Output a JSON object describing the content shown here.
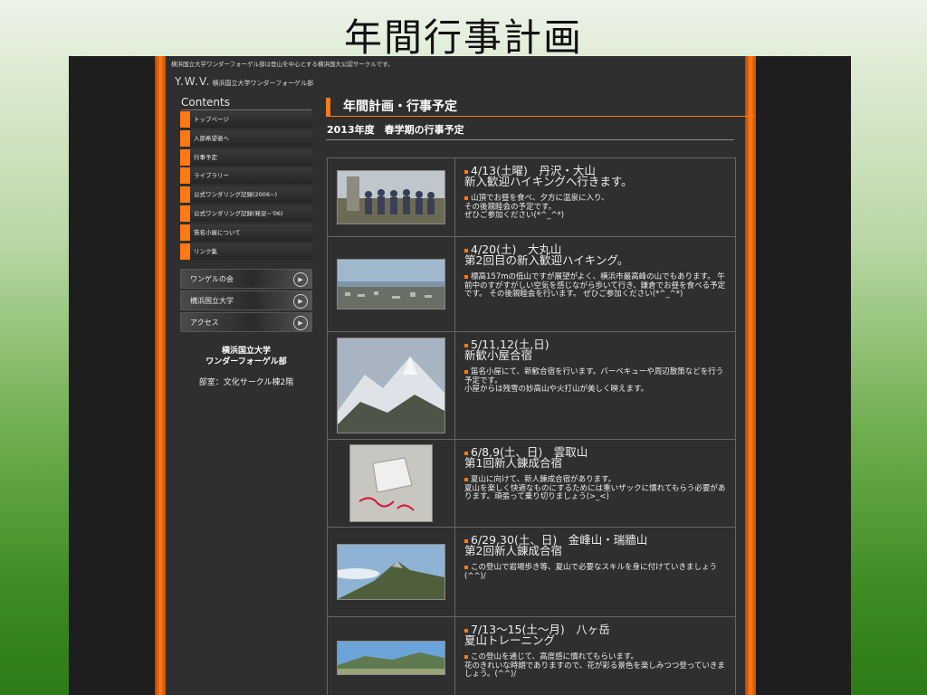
{
  "slide": {
    "title": "年間行事計画"
  },
  "site": {
    "top_note": "横浜国立大学ワンダーフォーゲル部は登山を中心とする横浜国大公認サークルです。",
    "logo": "Y.W.V.",
    "logo_sub": "横浜国立大学ワンダーフォーゲル部",
    "contents_heading": "Contents",
    "nav": [
      {
        "label": "トップページ"
      },
      {
        "label": "入部希望者へ"
      },
      {
        "label": "行事予定"
      },
      {
        "label": "ライブラリー"
      },
      {
        "label": "公式ワンダリング記録(2006~)"
      },
      {
        "label": "公式ワンダリング記録(発足~'06)"
      },
      {
        "label": "笛名小屋について"
      },
      {
        "label": "リンク集"
      }
    ],
    "banners": [
      {
        "label": "ワンゲルの会"
      },
      {
        "label": "横浜国立大学"
      },
      {
        "label": "アクセス"
      }
    ],
    "club_name": "横浜国立大学\nワンダーフォーゲル部",
    "club_room": "部室：文化サークル棟2階"
  },
  "main": {
    "heading": "年間計画・行事予定",
    "subheading": "2013年度　春学期の行事予定",
    "events": [
      {
        "title": "4/13(土曜)　丹沢・大山\n新入歓迎ハイキングへ行きます。",
        "desc": "山頂でお昼を食べ、夕方に温泉に入り、\nその後親睦会の予定です。\nぜひご参加ください(*^_^*)",
        "photo": "group-photo"
      },
      {
        "title": "4/20(土)　大丸山\n第2回目の新入歓迎ハイキング。",
        "desc": "標高157mの低山ですが展望がよく、横浜市最高峰の山でもあります。 午前中のすがすがしい空気を感じながら歩いて行き、鎌倉でお昼を食べる予定です。 その後親睦会を行います。 ぜひご参加ください(*^_^*)",
        "photo": "city-view-photo"
      },
      {
        "title": "5/11,12(土,日)\n新歓小屋合宿",
        "desc": "笛名小屋にて、新歓合宿を行います。バーベキューや周辺散策などを行う予定です。\n小屋からは残雪の妙高山や火打山が美しく映えます。",
        "photo": "snow-mountain-photo"
      },
      {
        "title": "6/8,9(土、日)　雲取山\n第1回新人錬成合宿",
        "desc": "夏山に向けて、新人錬成合宿があります。\n夏山を楽しく快適なものにするためには重いザックに慣れてもらう必要があります。頑張って乗り切りましょう(>_<)",
        "photo": "summit-marker-photo"
      },
      {
        "title": "6/29,30(土、日)　金峰山・瑞牆山\n第2回新人錬成合宿",
        "desc": "この登山で岩場歩き等、夏山で必要なスキルを身に付けていきましょう(^^)/",
        "photo": "rocky-peak-photo"
      },
      {
        "title": "7/13～15(土～月)　八ヶ岳\n夏山トレーニング",
        "desc": "この登山を通じて、高度感に慣れてもらいます。\n花のきれいな時期でありますので、花が彩る景色を楽しみつつ登っていきましょう。(^^)/",
        "photo": "ridge-panorama-photo"
      }
    ]
  },
  "colors": {
    "accent": "#ff7a14",
    "page_bg": "#2f2f2f",
    "slide_bg_bottom": "#2d7a17"
  }
}
